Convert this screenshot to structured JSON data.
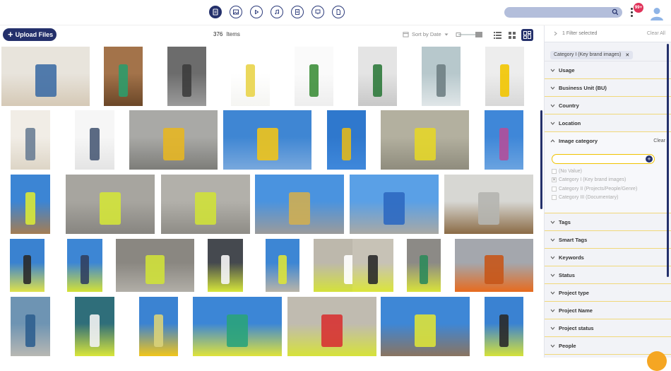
{
  "header": {
    "asset_types": [
      {
        "icon": "document-icon",
        "active": true
      },
      {
        "icon": "image-icon",
        "active": false
      },
      {
        "icon": "video-icon",
        "active": false
      },
      {
        "icon": "audio-icon",
        "active": false
      },
      {
        "icon": "file-icon",
        "active": false
      },
      {
        "icon": "presentation-icon",
        "active": false
      },
      {
        "icon": "page-icon",
        "active": false
      }
    ],
    "search": {
      "placeholder": "",
      "value": ""
    },
    "notifications": "99+"
  },
  "toolbar": {
    "upload_label": "Upload Files",
    "item_count": "376",
    "item_label": "Items",
    "sort_label": "Sort by Date"
  },
  "grid": {
    "thumbnails": [
      {
        "label": "person-sitting-on-blocks",
        "colors": [
          "#e8e4dc",
          "#d5c9b6",
          "#3f6ea5"
        ]
      },
      {
        "label": "person-green-coat-wood-wall",
        "colors": [
          "#a3734a",
          "#6b4728",
          "#2e9b6a"
        ]
      },
      {
        "label": "concrete-staircases",
        "colors": [
          "#6c6c6c",
          "#9a9a9a",
          "#3d3d3d"
        ]
      },
      {
        "label": "person-yellow-sweater-profile",
        "colors": [
          "#ffffff",
          "#f5f5f2",
          "#e9d44a"
        ]
      },
      {
        "label": "person-green-sweater",
        "colors": [
          "#fafafa",
          "#eeeeee",
          "#3e8f3b"
        ]
      },
      {
        "label": "person-green-on-stairs",
        "colors": [
          "#e4e4e4",
          "#c8c8c8",
          "#2f7a3c"
        ]
      },
      {
        "label": "glass-atrium-stairs",
        "colors": [
          "#b7c8cc",
          "#e0e6e8",
          "#6f7f84"
        ]
      },
      {
        "label": "person-yellow-jacket-white-wall",
        "colors": [
          "#ededed",
          "#d8d8d8",
          "#f2c500"
        ]
      },
      {
        "label": "two-people-on-blocks",
        "colors": [
          "#f1ede6",
          "#ddd5c6",
          "#6c7e95"
        ]
      },
      {
        "label": "person-back-of-head",
        "colors": [
          "#f6f6f6",
          "#e4e4e4",
          "#4a5b77"
        ]
      },
      {
        "label": "concrete-wall-yellow-pipes",
        "colors": [
          "#a9a9a6",
          "#7d7d79",
          "#e6b623"
        ]
      },
      {
        "label": "yellow-pipe-orange-tie",
        "colors": [
          "#3f86d3",
          "#78a8dd",
          "#f0c419"
        ]
      },
      {
        "label": "yellow-pipes-blue-sky",
        "colors": [
          "#2f78cd",
          "#3f88db",
          "#e2b81c"
        ]
      },
      {
        "label": "workers-with-rebar",
        "colors": [
          "#b3b09f",
          "#8f8c7d",
          "#e4d629"
        ]
      },
      {
        "label": "worker-carrying-cable",
        "colors": [
          "#3f87d8",
          "#6aa3e0",
          "#b14f9a"
        ]
      },
      {
        "label": "scaffold-worker",
        "colors": [
          "#3c85d4",
          "#a47d53",
          "#d8e838"
        ]
      },
      {
        "label": "concrete-hall-worker",
        "colors": [
          "#a7a59f",
          "#878580",
          "#d3e43a"
        ]
      },
      {
        "label": "concrete-hall-two-workers",
        "colors": [
          "#b2b0aa",
          "#8e8c86",
          "#cfe13a"
        ]
      },
      {
        "label": "concrete-wall-excavator",
        "colors": [
          "#4a93df",
          "#9b9b9b",
          "#cfae52"
        ]
      },
      {
        "label": "concrete-wall-rebar-blue-cable",
        "colors": [
          "#5aa0e6",
          "#a9a9a5",
          "#2d69c1"
        ]
      },
      {
        "label": "rebar-grid-formwork",
        "colors": [
          "#d7d7d3",
          "#8b6b45",
          "#b5b5b0"
        ]
      },
      {
        "label": "worker-white-helmet-glasses",
        "colors": [
          "#3a82d0",
          "#dfe24a",
          "#2a2a2a"
        ]
      },
      {
        "label": "worker-on-phone",
        "colors": [
          "#3d86d4",
          "#d4e236",
          "#314060"
        ]
      },
      {
        "label": "empty-concrete-hall-workers",
        "colors": [
          "#8a8781",
          "#b1aea7",
          "#cfe13a"
        ]
      },
      {
        "label": "worker-smiling-helmet",
        "colors": [
          "#45494f",
          "#d6e63a",
          "#f5f5f5"
        ]
      },
      {
        "label": "worker-with-drill",
        "colors": [
          "#3d86d4",
          "#b9b4a8",
          "#dbe33a"
        ]
      },
      {
        "label": "worker-gravel-kneeling",
        "colors": [
          "#bdb8ac",
          "#d4e13a",
          "#ffffff"
        ]
      },
      {
        "label": "worker-gravel-standing",
        "colors": [
          "#c7c2b6",
          "#dbe53a",
          "#2a2a2a"
        ]
      },
      {
        "label": "worker-green-pipe",
        "colors": [
          "#8c8a86",
          "#d9e33a",
          "#2e8a5b"
        ]
      },
      {
        "label": "orange-pipes-stacked",
        "colors": [
          "#a4a7ad",
          "#e76b1e",
          "#c7561a"
        ]
      },
      {
        "label": "blue-cylinder-number",
        "colors": [
          "#6e94b3",
          "#b8b8b3",
          "#2f5f8f"
        ]
      },
      {
        "label": "worker-teal-scaffold",
        "colors": [
          "#2f6e7a",
          "#d9e63a",
          "#f2f2f2"
        ]
      },
      {
        "label": "yellow-pipe-coil",
        "colors": [
          "#3b83d2",
          "#f1c51b",
          "#d9d27a"
        ]
      },
      {
        "label": "worker-pulling-hose",
        "colors": [
          "#3c86d6",
          "#dfe33a",
          "#2aa37b"
        ]
      },
      {
        "label": "workers-crouching-gravel",
        "colors": [
          "#c0bbb0",
          "#d6e23a",
          "#d73333"
        ]
      },
      {
        "label": "rebar-structure-worker",
        "colors": [
          "#3e87d6",
          "#8a7460",
          "#dbe23a"
        ]
      },
      {
        "label": "worker-sky-helmet",
        "colors": [
          "#3a82d2",
          "#d5e23a",
          "#2a2a2a"
        ]
      }
    ]
  },
  "filters": {
    "selected_label": "1 Filter selected",
    "clear_all": "Clear All",
    "chip": "Category I (Key brand images)",
    "sections": {
      "usage": "Usage",
      "business_unit": "Business Unit (BU)",
      "country": "Country",
      "location": "Location",
      "image_category": "Image category",
      "tags": "Tags",
      "smart_tags": "Smart Tags",
      "keywords": "Keywords",
      "status": "Status",
      "project_type": "Project type",
      "project_name": "Project Name",
      "project_status": "Project status",
      "people": "People"
    },
    "image_category_clear": "Clear",
    "image_category_search": {
      "placeholder": "",
      "value": ""
    },
    "image_category_options": [
      {
        "label": "(No Value)",
        "checked": false
      },
      {
        "label": "Category I (Key brand images)",
        "checked": true
      },
      {
        "label": "Category II (Projects/People/Genre)",
        "checked": false
      },
      {
        "label": "Category III (Documentary)",
        "checked": false
      }
    ]
  },
  "colors": {
    "accent": "#24306b",
    "search": "#b3bedb",
    "badge": "#e0335a",
    "divider": "#f0d87a",
    "help": "#f5a623"
  }
}
